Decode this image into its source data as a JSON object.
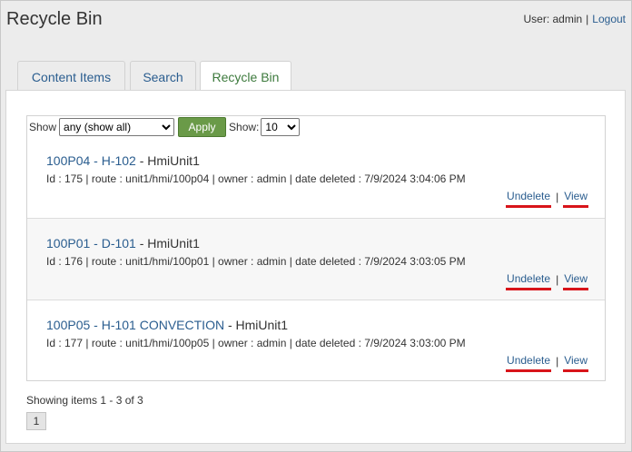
{
  "header": {
    "title": "Recycle Bin",
    "user_label": "User: admin",
    "separator": "|",
    "logout": "Logout"
  },
  "tabs": [
    {
      "label": "Content Items",
      "active": false
    },
    {
      "label": "Search",
      "active": false
    },
    {
      "label": "Recycle Bin",
      "active": true
    }
  ],
  "filters": {
    "show_label": "Show",
    "type_selected": "any (show all)",
    "apply_label": "Apply",
    "count_label": "Show:",
    "count_selected": "10"
  },
  "items": [
    {
      "link": "100P04 - H-102",
      "suffix": " - HmiUnit1",
      "meta": "Id : 175 | route : unit1/hmi/100p04 | owner : admin | date deleted : 7/9/2024 3:04:06 PM",
      "undelete": "Undelete",
      "separator": "|",
      "view": "View"
    },
    {
      "link": "100P01 - D-101",
      "suffix": " - HmiUnit1",
      "meta": "Id : 176 | route : unit1/hmi/100p01 | owner : admin | date deleted : 7/9/2024 3:03:05 PM",
      "undelete": "Undelete",
      "separator": "|",
      "view": "View"
    },
    {
      "link": "100P05 - H-101 CONVECTION",
      "suffix": " - HmiUnit1",
      "meta": "Id : 177 | route : unit1/hmi/100p05 | owner : admin | date deleted : 7/9/2024 3:03:00 PM",
      "undelete": "Undelete",
      "separator": "|",
      "view": "View"
    }
  ],
  "pager": {
    "status": "Showing items 1 - 3 of 3",
    "pages": [
      "1"
    ]
  },
  "colors": {
    "link": "#2a5d8f",
    "active_tab": "#3d7a3d",
    "apply_button": "#6a9a48",
    "action_underline": "#d8141a"
  }
}
